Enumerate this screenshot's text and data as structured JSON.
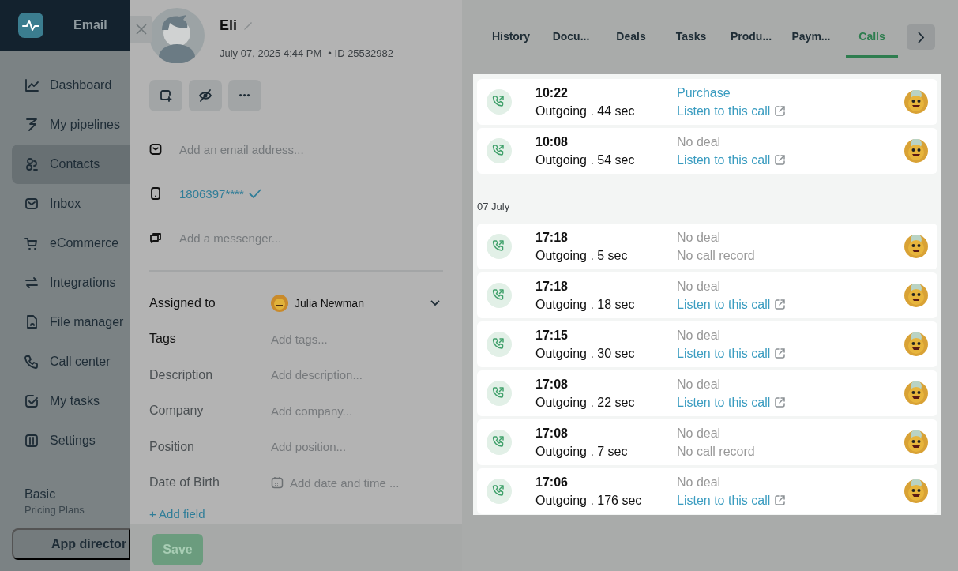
{
  "sidebar": {
    "brand": "Email",
    "items": [
      {
        "label": "Dashboard",
        "selected": false
      },
      {
        "label": "My pipelines",
        "selected": false
      },
      {
        "label": "Contacts",
        "selected": true
      },
      {
        "label": "Inbox",
        "selected": false
      },
      {
        "label": "eCommerce",
        "selected": false
      },
      {
        "label": "Integrations",
        "selected": false
      },
      {
        "label": "File manager",
        "selected": false
      },
      {
        "label": "Call center",
        "selected": false
      },
      {
        "label": "My tasks",
        "selected": false
      },
      {
        "label": "Settings",
        "selected": false
      }
    ],
    "plan": {
      "name": "Basic",
      "caption": "Pricing Plans"
    },
    "app_directory": "App director"
  },
  "contact": {
    "name": "Eli",
    "created": "July 07, 2025 4:44 PM",
    "id": "• ID 25532982",
    "channels": [
      {
        "kind": "email",
        "placeholder": "Add an email address..."
      },
      {
        "kind": "phone",
        "value": "1806397****",
        "verified": true
      },
      {
        "kind": "messenger",
        "placeholder": "Add a messenger..."
      }
    ],
    "properties": [
      {
        "kind": "user",
        "label": "Assigned to",
        "value": "Julia Newman"
      },
      {
        "kind": "tags",
        "label": "Tags",
        "placeholder": "Add tags..."
      },
      {
        "kind": "text",
        "label": "Description",
        "placeholder": "Add description..."
      },
      {
        "kind": "text",
        "label": "Company",
        "placeholder": "Add company..."
      },
      {
        "kind": "text",
        "label": "Position",
        "placeholder": "Add position..."
      },
      {
        "kind": "date",
        "label": "Date of Birth",
        "placeholder": "Add date and time ..."
      }
    ],
    "add_field": "+ Add field",
    "save": "Save"
  },
  "tabs": [
    {
      "label": "History",
      "selected": false
    },
    {
      "label": "Docu...",
      "selected": false
    },
    {
      "label": "Deals",
      "selected": false
    },
    {
      "label": "Tasks",
      "selected": false
    },
    {
      "label": "Produ...",
      "selected": false
    },
    {
      "label": "Paym...",
      "selected": false
    },
    {
      "label": "Calls",
      "selected": true
    }
  ],
  "call_groups": [
    {
      "calls": [
        {
          "time": "10:22",
          "summary": "Outgoing . 44 sec",
          "deal": {
            "kind": "link",
            "text": "Purchase"
          },
          "record": {
            "kind": "link",
            "text": "Listen to this call"
          }
        },
        {
          "time": "10:08",
          "summary": "Outgoing . 54 sec",
          "deal": {
            "kind": "none",
            "text": "No deal"
          },
          "record": {
            "kind": "link",
            "text": "Listen to this call"
          }
        }
      ]
    },
    {
      "label": "07 July",
      "calls": [
        {
          "time": "17:18",
          "summary": "Outgoing . 5 sec",
          "deal": {
            "kind": "none",
            "text": "No deal"
          },
          "record": {
            "kind": "none",
            "text": "No call record"
          }
        },
        {
          "time": "17:18",
          "summary": "Outgoing . 18 sec",
          "deal": {
            "kind": "none",
            "text": "No deal"
          },
          "record": {
            "kind": "link",
            "text": "Listen to this call"
          }
        },
        {
          "time": "17:15",
          "summary": "Outgoing . 30 sec",
          "deal": {
            "kind": "none",
            "text": "No deal"
          },
          "record": {
            "kind": "link",
            "text": "Listen to this call"
          }
        },
        {
          "time": "17:08",
          "summary": "Outgoing . 22 sec",
          "deal": {
            "kind": "none",
            "text": "No deal"
          },
          "record": {
            "kind": "link",
            "text": "Listen to this call"
          }
        },
        {
          "time": "17:08",
          "summary": "Outgoing . 7 sec",
          "deal": {
            "kind": "none",
            "text": "No deal"
          },
          "record": {
            "kind": "none",
            "text": "No call record"
          }
        },
        {
          "time": "17:06",
          "summary": "Outgoing . 176 sec",
          "deal": {
            "kind": "none",
            "text": "No deal"
          },
          "record": {
            "kind": "link",
            "text": "Listen to this call"
          }
        }
      ]
    }
  ]
}
